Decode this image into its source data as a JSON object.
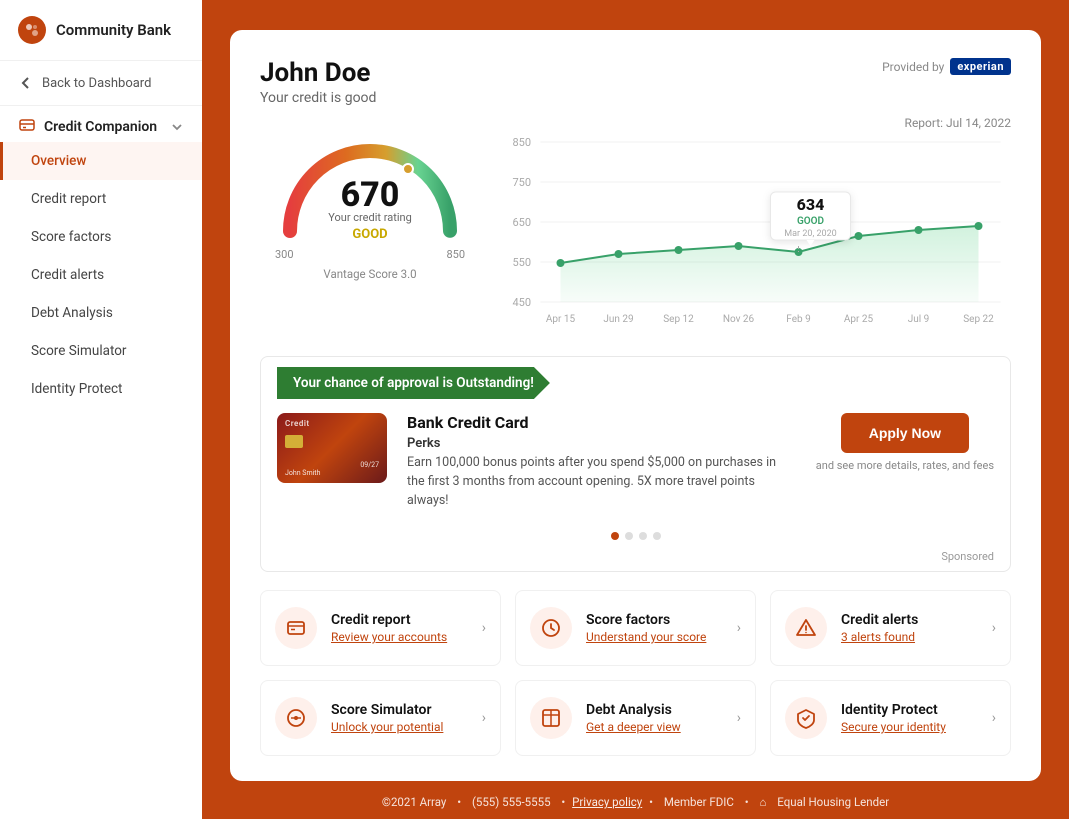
{
  "sidebar": {
    "logo_text": "Community Bank",
    "back_label": "Back to Dashboard",
    "section_label": "Credit Companion",
    "nav_items": [
      {
        "id": "overview",
        "label": "Overview",
        "active": true
      },
      {
        "id": "credit-report",
        "label": "Credit report",
        "active": false
      },
      {
        "id": "score-factors",
        "label": "Score factors",
        "active": false
      },
      {
        "id": "credit-alerts",
        "label": "Credit alerts",
        "active": false
      },
      {
        "id": "debt-analysis",
        "label": "Debt Analysis",
        "active": false
      },
      {
        "id": "score-simulator",
        "label": "Score Simulator",
        "active": false
      },
      {
        "id": "identity-protect",
        "label": "Identity Protect",
        "active": false
      }
    ]
  },
  "header": {
    "name": "John Doe",
    "subtitle": "Your credit is good",
    "provided_by": "Provided by",
    "experian": "experian",
    "report_date": "Report: Jul 14, 2022"
  },
  "gauge": {
    "score": "670",
    "label": "Your credit rating",
    "rating": "GOOD",
    "min": "300",
    "max": "850",
    "vantage": "Vantage Score 3.0"
  },
  "chart": {
    "y_labels": [
      "850",
      "750",
      "650",
      "550",
      "450"
    ],
    "x_labels": [
      "Apr 15",
      "Jun 29",
      "Sep 12",
      "Nov 26",
      "Feb 9",
      "Apr 25",
      "Jul 9",
      "Sep 22"
    ],
    "tooltip_score": "634",
    "tooltip_rating": "GOOD",
    "tooltip_date": "Mar 20, 2020"
  },
  "approval": {
    "banner": "Your chance of approval is Outstanding!",
    "card_label": "Credit",
    "card_holder": "John Smith",
    "card_number": "09/27",
    "offer_title": "Bank Credit Card",
    "perks_label": "Perks",
    "perks_text": "Earn 100,000 bonus points after you spend $5,000 on purchases in the first 3 months from account opening. 5X more travel points always!",
    "apply_btn": "Apply Now",
    "fine_print": "and see more details, rates, and fees",
    "sponsored": "Sponsored"
  },
  "features": [
    {
      "id": "credit-report-card",
      "icon": "credit-report-icon",
      "title": "Credit report",
      "sub": "Review your accounts"
    },
    {
      "id": "score-factors-card",
      "icon": "score-factors-icon",
      "title": "Score factors",
      "sub": "Understand your score"
    },
    {
      "id": "credit-alerts-card",
      "icon": "credit-alerts-icon",
      "title": "Credit alerts",
      "sub": "3 alerts found"
    },
    {
      "id": "score-simulator-card",
      "icon": "score-simulator-icon",
      "title": "Score Simulator",
      "sub": "Unlock your potential"
    },
    {
      "id": "debt-analysis-card",
      "icon": "debt-analysis-icon",
      "title": "Debt Analysis",
      "sub": "Get a deeper view"
    },
    {
      "id": "identity-protect-card",
      "icon": "identity-protect-icon",
      "title": "Identity Protect",
      "sub": "Secure your identity"
    }
  ],
  "footer": {
    "copyright": "©2021 Array",
    "phone": "(555) 555-5555",
    "privacy": "Privacy policy",
    "fdic": "Member FDIC",
    "housing": "Equal Housing Lender"
  }
}
